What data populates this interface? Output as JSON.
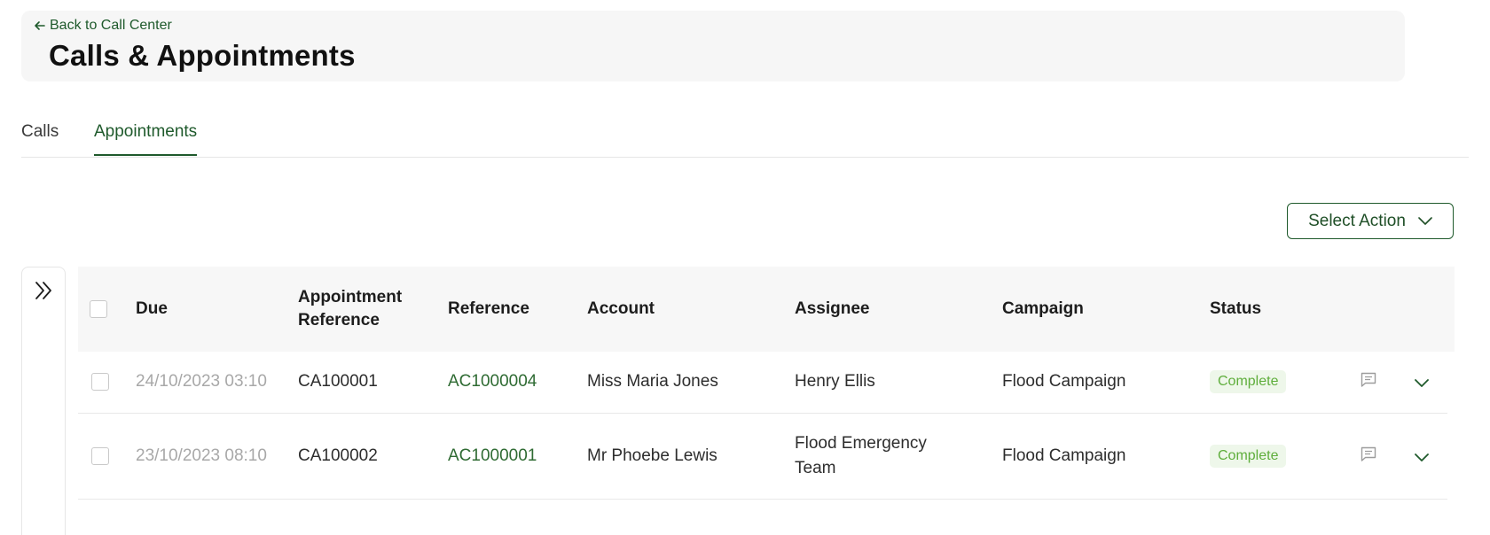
{
  "header": {
    "back_label": "Back to Call Center",
    "title": "Calls & Appointments"
  },
  "tabs": [
    {
      "label": "Calls",
      "active": false
    },
    {
      "label": "Appointments",
      "active": true
    }
  ],
  "toolbar": {
    "select_action_label": "Select Action"
  },
  "table": {
    "columns": {
      "due": "Due",
      "appointment_reference": "Appointment Reference",
      "reference": "Reference",
      "account": "Account",
      "assignee": "Assignee",
      "campaign": "Campaign",
      "status": "Status"
    },
    "rows": [
      {
        "due": "24/10/2023 03:10",
        "appointment_reference": "CA100001",
        "reference": "AC1000004",
        "account": "Miss Maria Jones",
        "assignee": "Henry Ellis",
        "campaign": "Flood Campaign",
        "status": "Complete"
      },
      {
        "due": "23/10/2023 08:10",
        "appointment_reference": "CA100002",
        "reference": "AC1000001",
        "account": "Mr Phoebe Lewis",
        "assignee": "Flood Emergency Team",
        "campaign": "Flood Campaign",
        "status": "Complete"
      }
    ]
  },
  "colors": {
    "accent": "#1f5a2c",
    "status_complete_bg": "#eef7ea",
    "status_complete_text": "#5fae3c"
  },
  "icons": {
    "back": "arrow-left-icon",
    "sidebar_toggle": "double-chevron-right-icon",
    "dropdown": "chevron-down-icon",
    "notes": "comment-icon",
    "expand": "chevron-down-icon"
  }
}
